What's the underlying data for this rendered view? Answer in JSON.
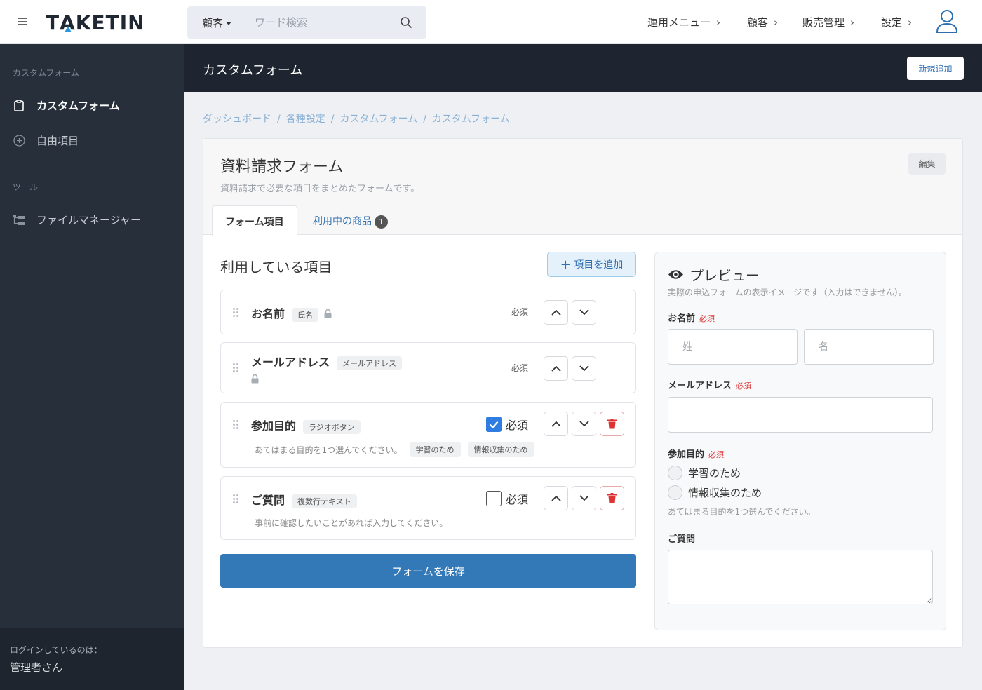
{
  "app": {
    "logo": "TAKETIN"
  },
  "search": {
    "scope": "顧客",
    "placeholder": "ワード検索"
  },
  "topnav": [
    "運用メニュー",
    "顧客",
    "販売管理",
    "設定"
  ],
  "sidebar": {
    "section1": "カスタムフォーム",
    "items1": [
      {
        "label": "カスタムフォーム",
        "icon": "clipboard-icon",
        "active": true
      },
      {
        "label": "自由項目",
        "icon": "plus-circle-icon",
        "active": false
      }
    ],
    "section2": "ツール",
    "items2": [
      {
        "label": "ファイルマネージャー",
        "icon": "file-tree-icon"
      }
    ],
    "footer": {
      "line1": "ログインしているのは：",
      "line2": "管理者さん"
    }
  },
  "page": {
    "title": "カスタムフォーム",
    "new_button": "新規追加"
  },
  "breadcrumb": [
    "ダッシュボード",
    "各種設定",
    "カスタムフォーム",
    "カスタムフォーム"
  ],
  "form": {
    "title": "資料請求フォーム",
    "description": "資料請求で必要な項目をまとめたフォームです。",
    "edit_button": "編集",
    "tabs": [
      {
        "label": "フォーム項目"
      },
      {
        "label": "利用中の商品",
        "badge": "1"
      }
    ]
  },
  "fields_section": {
    "title": "利用している項目",
    "add_button": "項目を追加",
    "items": [
      {
        "name": "お名前",
        "type": "氏名",
        "required_label": "必須",
        "locked": true
      },
      {
        "name": "メールアドレス",
        "type": "メールアドレス",
        "required_label": "必須",
        "locked": true
      },
      {
        "name": "参加目的",
        "type": "ラジオボタン",
        "required_label": "必須",
        "required": true,
        "help": "あてはまる目的を1つ選んでください。",
        "options": [
          "学習のため",
          "情報収集のため"
        ]
      },
      {
        "name": "ご質問",
        "type": "複数行テキスト",
        "required_label": "必須",
        "required": false,
        "help": "事前に確認したいことがあれば入力してください。"
      }
    ],
    "save_button": "フォームを保存"
  },
  "preview": {
    "title": "プレビュー",
    "description": "実際の申込フォームの表示イメージです（入力はできません）。",
    "required_mark": "必須",
    "name_label": "お名前",
    "last_name_placeholder": "姓",
    "first_name_placeholder": "名",
    "email_label": "メールアドレス",
    "purpose_label": "参加目的",
    "purpose_options": [
      "学習のため",
      "情報収集のため"
    ],
    "purpose_help": "あてはまる目的を1つ選んでください。",
    "question_label": "ご質問"
  },
  "colors": {
    "primary": "#3379b8",
    "sidebar": "#272f3b",
    "header": "#1f2530",
    "required": "#dd3333",
    "checkbox": "#2f7de1"
  }
}
